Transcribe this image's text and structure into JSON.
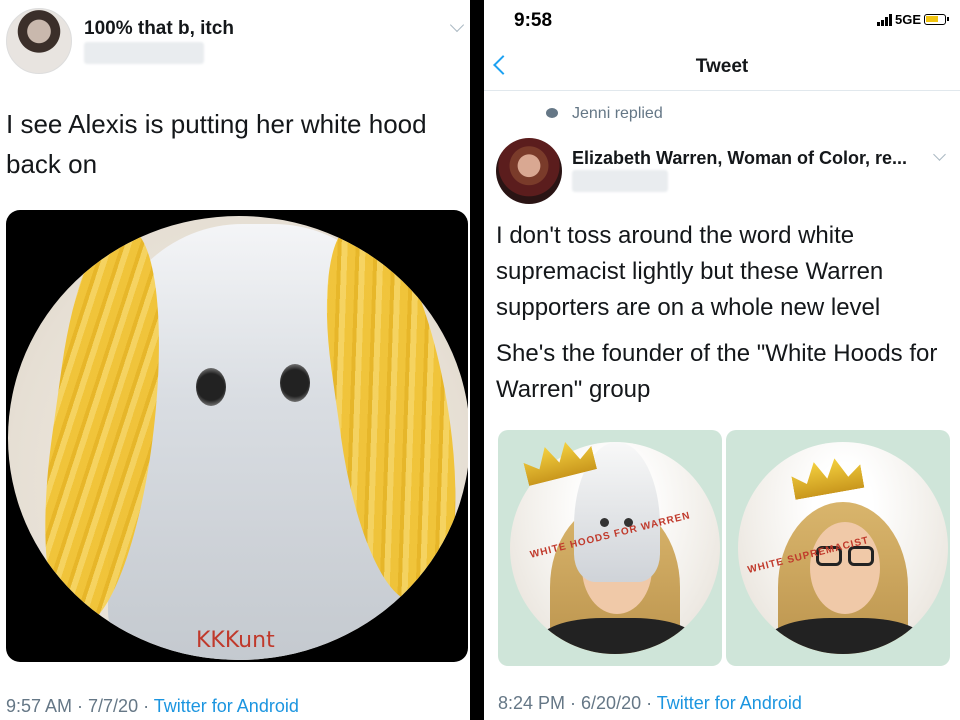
{
  "left_tweet": {
    "display_name": "100% that b, itch",
    "text": "I see Alexis is putting her white hood back on",
    "image_caption": "KKKunt",
    "timestamp": "9:57 AM · 7/7/20",
    "source": "Twitter for Android"
  },
  "right_tweet": {
    "status_bar": {
      "time": "9:58",
      "network": "5GE"
    },
    "header": {
      "title": "Tweet"
    },
    "replied_by": "Jenni replied",
    "display_name": "Elizabeth Warren, Woman of Color, re...",
    "text_1": "I don't toss around the word white supremacist lightly but these Warren supporters are on a whole new level",
    "text_2": "She's the founder of the \"White Hoods for Warren\" group",
    "image_1_stamp": "WHITE HOODS FOR WARREN",
    "image_2_stamp": "WHITE SUPREMACIST",
    "timestamp": "8:24 PM · 6/20/20",
    "source": "Twitter for Android"
  },
  "colors": {
    "link": "#1b95e0",
    "meta_gray": "#657786",
    "text": "#14171a",
    "scribble": "#f1c232"
  }
}
